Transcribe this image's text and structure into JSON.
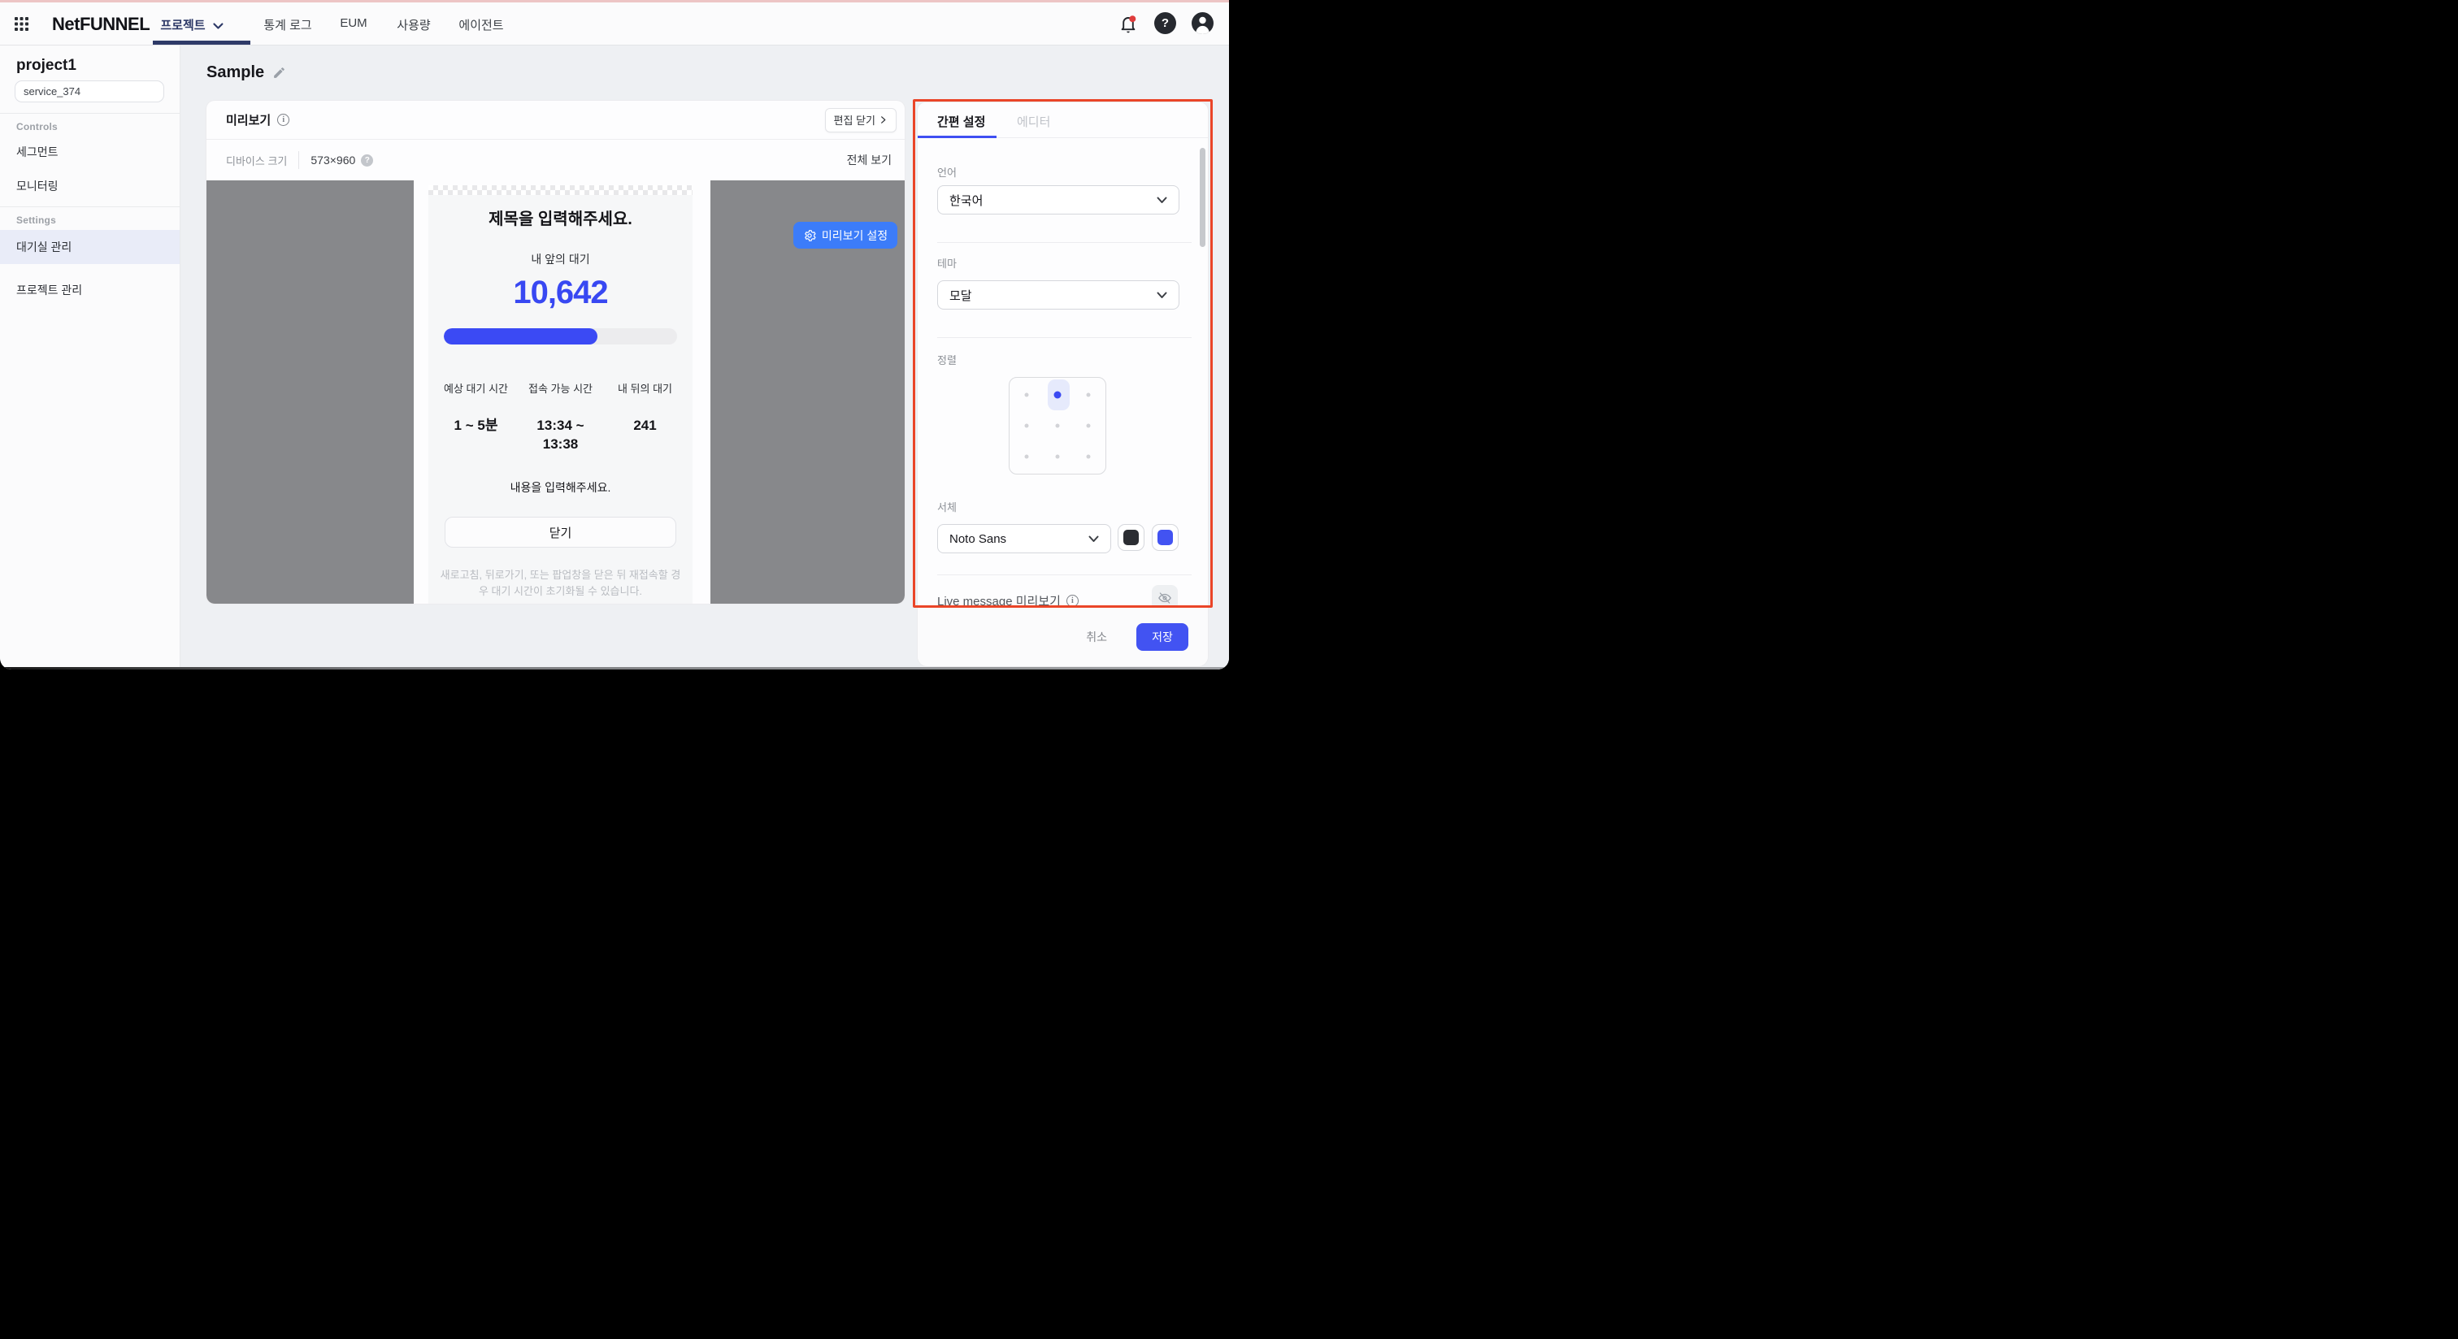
{
  "header": {
    "logo": "NetFUNNEL",
    "nav": [
      {
        "label": "프로젝트"
      },
      {
        "label": "통계 로그"
      },
      {
        "label": "EUM"
      },
      {
        "label": "사용량"
      },
      {
        "label": "에이전트"
      }
    ],
    "help_glyph": "?"
  },
  "sidebar": {
    "project": "project1",
    "service": "service_374",
    "controls_label": "Controls",
    "settings_label": "Settings",
    "items": {
      "segment": "세그먼트",
      "monitoring": "모니터링",
      "waiting_room": "대기실 관리",
      "project_mgmt": "프로젝트 관리"
    }
  },
  "page": {
    "title": "Sample"
  },
  "preview": {
    "title": "미리보기",
    "edit_close": "편집 닫기",
    "edit_close_chevron": "›",
    "device_size_label": "디바이스 크기",
    "device_size": "573×960",
    "device_help_glyph": "?",
    "view_all": "전체 보기",
    "settings_button": "미리보기 설정"
  },
  "modal": {
    "title": "제목을 입력해주세요.",
    "ahead_label": "내 앞의 대기",
    "ahead_count": "10,642",
    "progress_percent": 66,
    "stats": [
      {
        "label": "예상 대기 시간",
        "value": "1 ~ 5분"
      },
      {
        "label": "접속 가능 시간",
        "value": "13:34 ~ 13:38"
      },
      {
        "label": "내 뒤의 대기",
        "value": "241"
      }
    ],
    "body": "내용을 입력해주세요.",
    "close": "닫기",
    "notice": "새로고침, 뒤로가기, 또는 팝업창을 닫은 뒤 재접속할 경우 대기 시간이 초기화될 수 있습니다."
  },
  "panel": {
    "tabs": [
      {
        "label": "간편 설정"
      },
      {
        "label": "에디터"
      }
    ],
    "language_label": "언어",
    "language": "한국어",
    "theme_label": "테마",
    "theme": "모달",
    "align_label": "정렬",
    "align_selected": "top-center",
    "font_label": "서체",
    "font": "Noto Sans",
    "font_colors": [
      "#2B2D32",
      "#4253F2"
    ],
    "live_label": "Live message 미리보기"
  },
  "actions": {
    "cancel": "취소",
    "save": "저장"
  },
  "colors": {
    "accent_indigo": "#3B4AF2",
    "save_button": "#4253F2",
    "preview_settings_button": "#3C7CF9",
    "annotation_red": "#EA4528",
    "nav_active_navy": "#2E3A68",
    "notification_dot": "#DF3C3C",
    "active_item_bg": "#E9ECF8"
  }
}
